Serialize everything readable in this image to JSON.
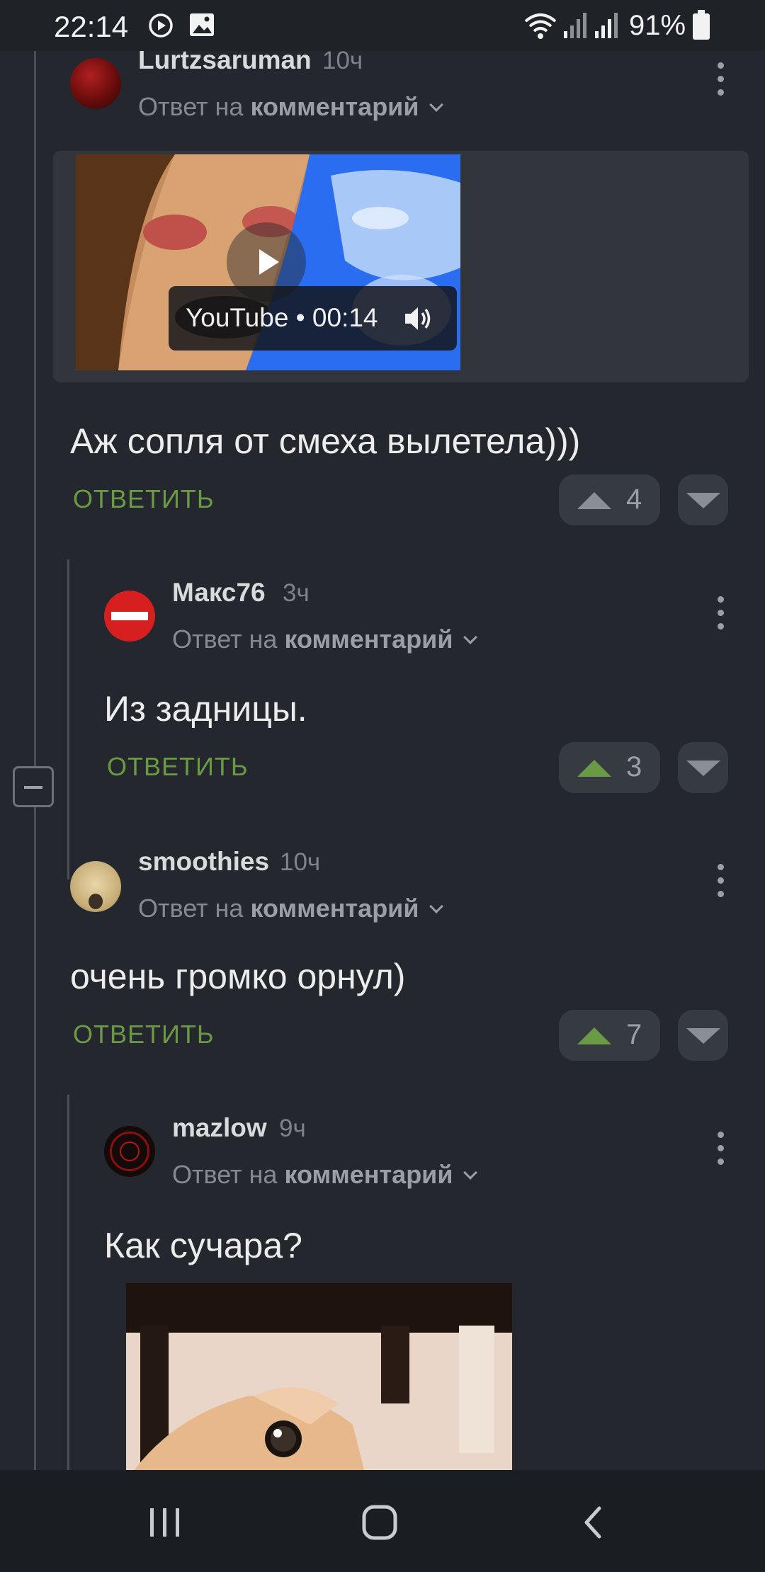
{
  "status_bar": {
    "time": "22:14",
    "battery": "91%",
    "icons": [
      "media-icon",
      "image-icon",
      "wifi-icon",
      "signal-icon",
      "signal-icon",
      "battery-icon"
    ]
  },
  "comments": [
    {
      "author": "Lurtzsaruman",
      "time": "10ч",
      "reply_prefix": "Ответ на",
      "reply_target": "комментарий",
      "media": {
        "type": "video",
        "label": "YouTube • 00:14"
      },
      "text": "Аж сопля от смеха вылетела)))",
      "reply_label": "ОТВЕТИТЬ",
      "votes": "4",
      "upvoted": false
    },
    {
      "author": "Макс76",
      "time": "3ч",
      "reply_prefix": "Ответ на",
      "reply_target": "комментарий",
      "text": "Из задницы.",
      "reply_label": "ОТВЕТИТЬ",
      "votes": "3",
      "upvoted": true
    },
    {
      "author": "smoothies",
      "time": "10ч",
      "reply_prefix": "Ответ на",
      "reply_target": "комментарий",
      "text": "очень громко орнул)",
      "reply_label": "ОТВЕТИТЬ",
      "votes": "7",
      "upvoted": true
    },
    {
      "author": "mazlow",
      "time": "9ч",
      "reply_prefix": "Ответ на",
      "reply_target": "комментарий",
      "text": "Как сучара?",
      "media": {
        "type": "image"
      }
    }
  ],
  "colors": {
    "background": "#24282e",
    "accent_green": "#6b9a44",
    "vote_bg": "#363b42"
  },
  "nav_bar": {
    "icons": [
      "recent-apps-icon",
      "home-icon",
      "back-icon"
    ]
  }
}
